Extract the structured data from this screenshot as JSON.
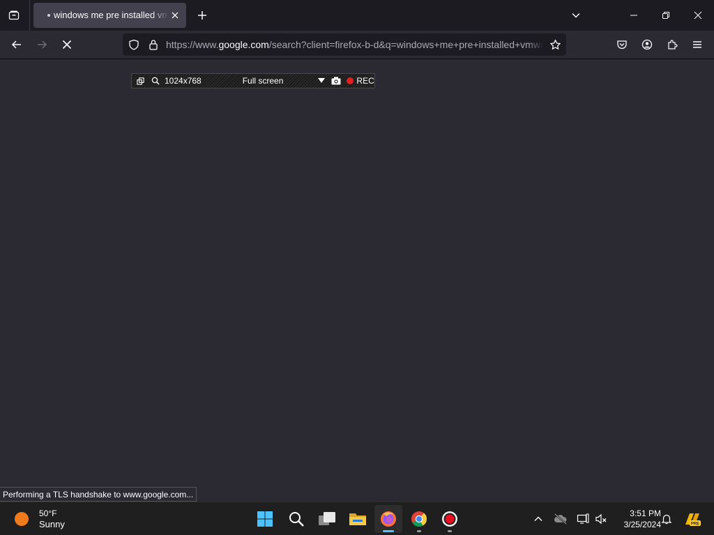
{
  "browser": {
    "tab": {
      "title": "windows me pre installed vmware"
    },
    "url": {
      "prefix": "https://www.",
      "host": "google.com",
      "path": "/search?client=firefox-b-d&q=windows+me+pre+installed+vmware"
    },
    "status_text": "Performing a TLS handshake to www.google.com..."
  },
  "recorder": {
    "resolution": "1024x768",
    "mode": "Full screen",
    "rec_label": "REC",
    "rec_color": "#e02020"
  },
  "taskbar": {
    "weather": {
      "temp": "50°F",
      "condition": "Sunny"
    },
    "clock": {
      "time": "3:51 PM",
      "date": "3/25/2024"
    },
    "apps": [
      "start",
      "search",
      "task-view",
      "file-explorer",
      "firefox",
      "chrome",
      "recorder"
    ]
  },
  "colors": {
    "tabbar_bg": "#1c1b22",
    "toolbar_bg": "#2b2a33",
    "active_tab_bg": "#42414d",
    "taskbar_bg": "#1f1f1f",
    "accent": "#4cc2ff"
  }
}
